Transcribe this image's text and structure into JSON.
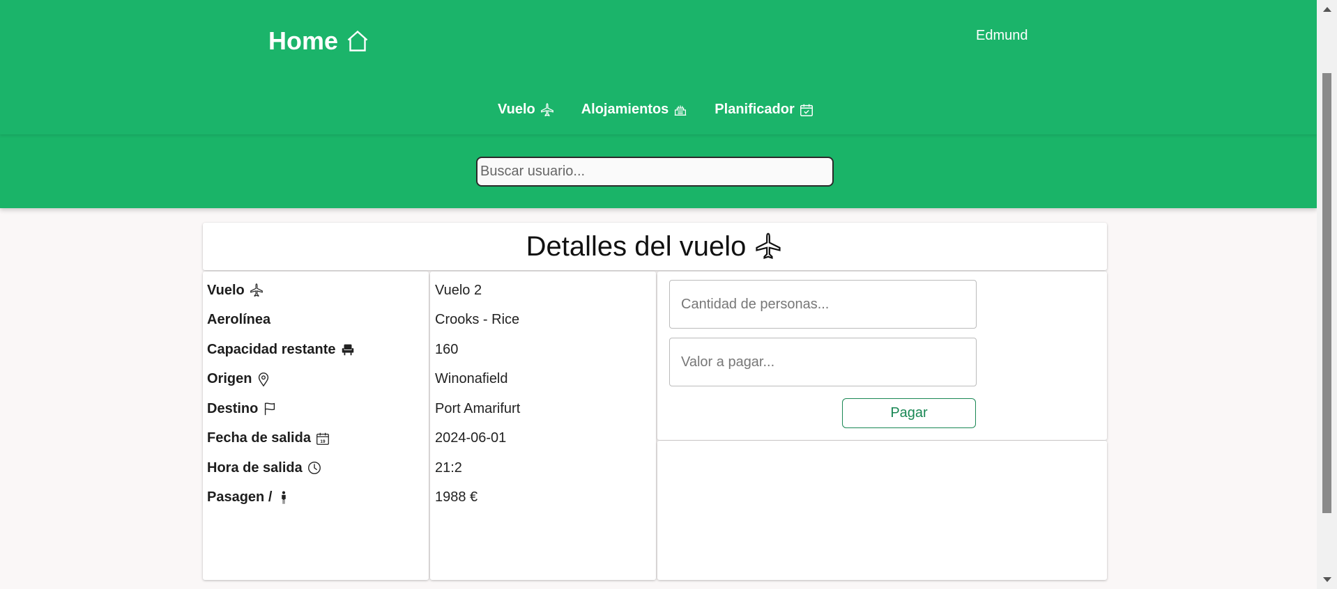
{
  "header": {
    "brand": "Home",
    "user": "Edmund",
    "nav": [
      {
        "label": "Vuelo",
        "icon": "airplane-icon"
      },
      {
        "label": "Alojamientos",
        "icon": "hotel-icon"
      },
      {
        "label": "Planificador",
        "icon": "calendar-check-icon"
      }
    ],
    "search_placeholder": "Buscar usuario..."
  },
  "page": {
    "title": "Detalles del vuelo"
  },
  "details": {
    "labels": [
      "Vuelo",
      "Aerolínea",
      "Capacidad restante",
      "Origen",
      "Destino",
      "Fecha de salida",
      "Hora de salida",
      "Pasagen /"
    ],
    "values": [
      "Vuelo 2",
      "Crooks - Rice",
      "160",
      "Winonafield",
      "Port Amarifurt",
      "2024-06-01",
      "21:2",
      "1988 €"
    ]
  },
  "form": {
    "people_placeholder": "Cantidad de personas...",
    "amount_placeholder": "Valor a pagar...",
    "pay_label": "Pagar"
  },
  "colors": {
    "header_green": "#1ab468",
    "button_green": "#198754"
  }
}
